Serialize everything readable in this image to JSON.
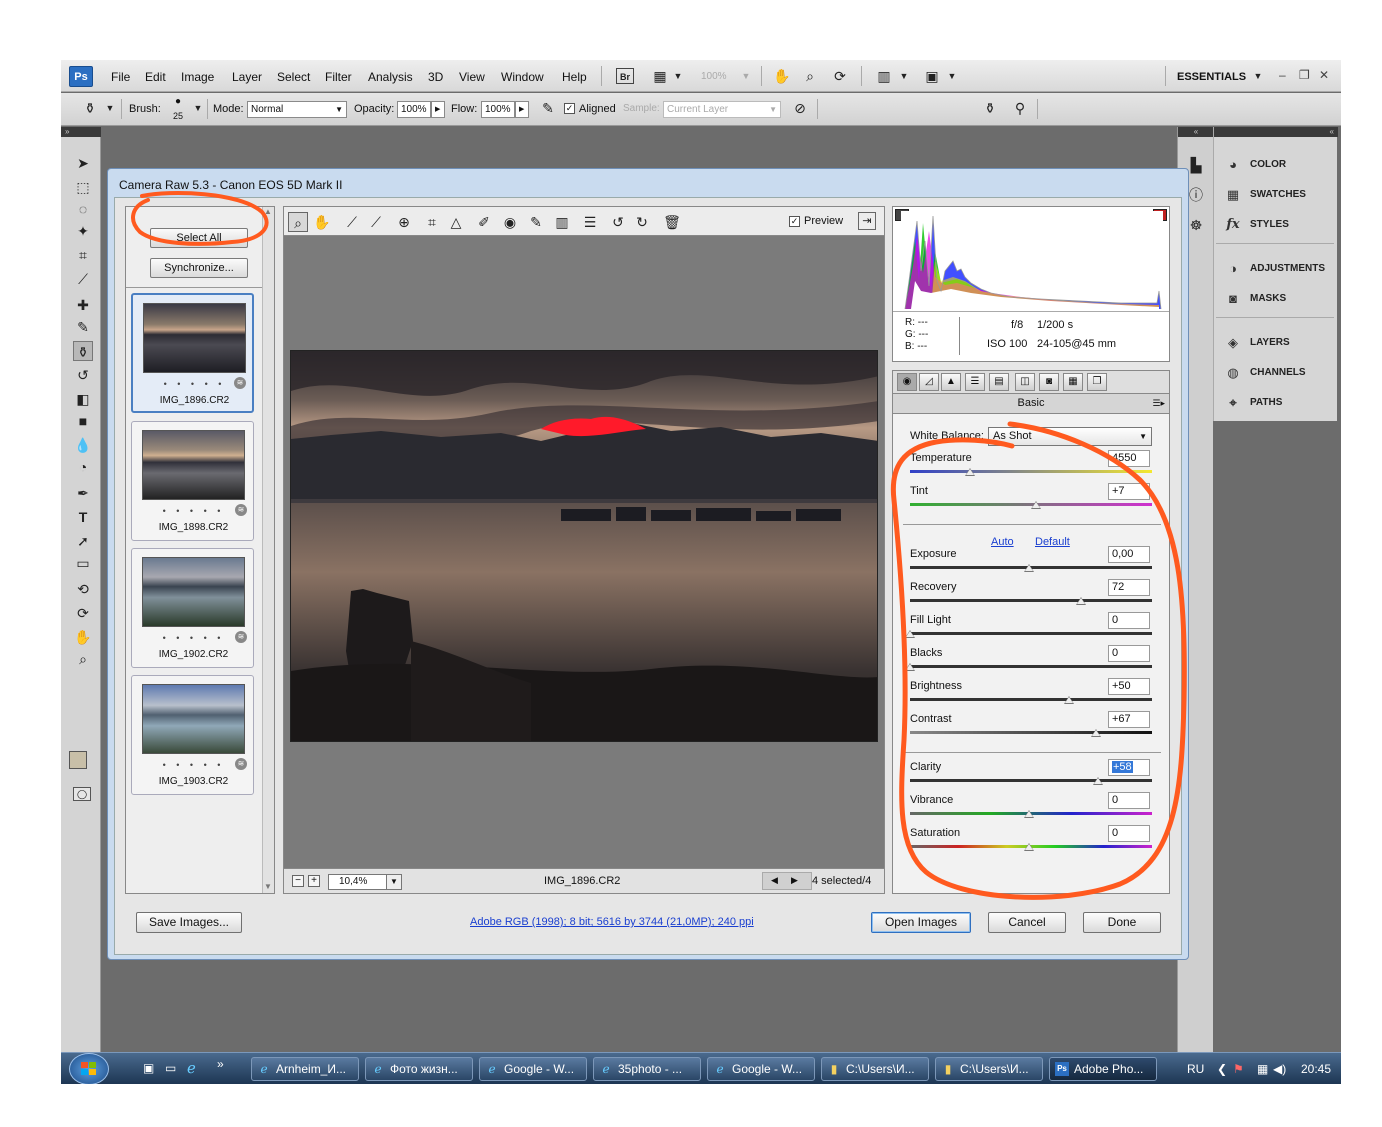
{
  "menubar": {
    "logo": "Ps",
    "items": [
      "File",
      "Edit",
      "Image",
      "Layer",
      "Select",
      "Filter",
      "Analysis",
      "3D",
      "View",
      "Window",
      "Help"
    ],
    "bridge": "Br",
    "zoom": "100%",
    "workspace": "ESSENTIALS"
  },
  "optionsbar": {
    "brush_label": "Brush:",
    "brush_size": "25",
    "mode_label": "Mode:",
    "mode_value": "Normal",
    "opacity_label": "Opacity:",
    "opacity_value": "100%",
    "flow_label": "Flow:",
    "flow_value": "100%",
    "aligned_label": "Aligned",
    "sample_label": "Sample:",
    "sample_value": "Current Layer"
  },
  "panels": [
    {
      "label": "COLOR",
      "icon": "color-icon"
    },
    {
      "label": "SWATCHES",
      "icon": "swatches-icon"
    },
    {
      "label": "STYLES",
      "icon": "styles-icon"
    },
    {
      "label": "ADJUSTMENTS",
      "icon": "adjustments-icon"
    },
    {
      "label": "MASKS",
      "icon": "masks-icon"
    },
    {
      "label": "LAYERS",
      "icon": "layers-icon"
    },
    {
      "label": "CHANNELS",
      "icon": "channels-icon"
    },
    {
      "label": "PATHS",
      "icon": "paths-icon"
    }
  ],
  "dialog": {
    "title": "Camera Raw 5.3  -  Canon EOS 5D Mark II",
    "select_all": "Select All",
    "synchronize": "Synchronize...",
    "thumbnails": [
      "IMG_1896.CR2",
      "IMG_1898.CR2",
      "IMG_1902.CR2",
      "IMG_1903.CR2"
    ],
    "thumb_dots": "• • • • •",
    "preview_label": "Preview",
    "zoom_value": "10,4%",
    "filename": "IMG_1896.CR2",
    "selected_count": "4 selected/4",
    "camera_info": {
      "r": "R:  ---",
      "g": "G:  ---",
      "b": "B:  ---",
      "aperture": "f/8",
      "shutter": "1/200 s",
      "iso": "ISO 100",
      "lens": "24-105@45 mm"
    },
    "panel_title": "Basic",
    "white_balance_label": "White Balance:",
    "white_balance_value": "As Shot",
    "auto_link": "Auto",
    "default_link": "Default",
    "sliders": {
      "temperature": {
        "label": "Temperature",
        "value": "4550",
        "pos": 0.25
      },
      "tint": {
        "label": "Tint",
        "value": "+7",
        "pos": 0.53
      },
      "exposure": {
        "label": "Exposure",
        "value": "0,00",
        "pos": 0.5
      },
      "recovery": {
        "label": "Recovery",
        "value": "72",
        "pos": 0.72
      },
      "fill_light": {
        "label": "Fill Light",
        "value": "0",
        "pos": 0.0
      },
      "blacks": {
        "label": "Blacks",
        "value": "0",
        "pos": 0.0
      },
      "brightness": {
        "label": "Brightness",
        "value": "+50",
        "pos": 0.67
      },
      "contrast": {
        "label": "Contrast",
        "value": "+67",
        "pos": 0.78
      },
      "clarity": {
        "label": "Clarity",
        "value": "+58",
        "pos": 0.79
      },
      "vibrance": {
        "label": "Vibrance",
        "value": "0",
        "pos": 0.5
      },
      "saturation": {
        "label": "Saturation",
        "value": "0",
        "pos": 0.5
      }
    },
    "save_images": "Save Images...",
    "workflow": "Adobe RGB (1998); 8 bit; 5616 by 3744 (21,0MP); 240 ppi",
    "open_images": "Open Images",
    "cancel": "Cancel",
    "done": "Done"
  },
  "taskbar": {
    "tasks": [
      "Arnheim_И...",
      "Фото жизн...",
      "Google - W...",
      "35photo - ...",
      "Google - W...",
      "C:\\Users\\И...",
      "C:\\Users\\И...",
      "Adobe Pho..."
    ],
    "lang": "RU",
    "time": "20:45"
  },
  "colors": {
    "annotation": "#ff5a1f",
    "accent": "#2b6fc2"
  }
}
